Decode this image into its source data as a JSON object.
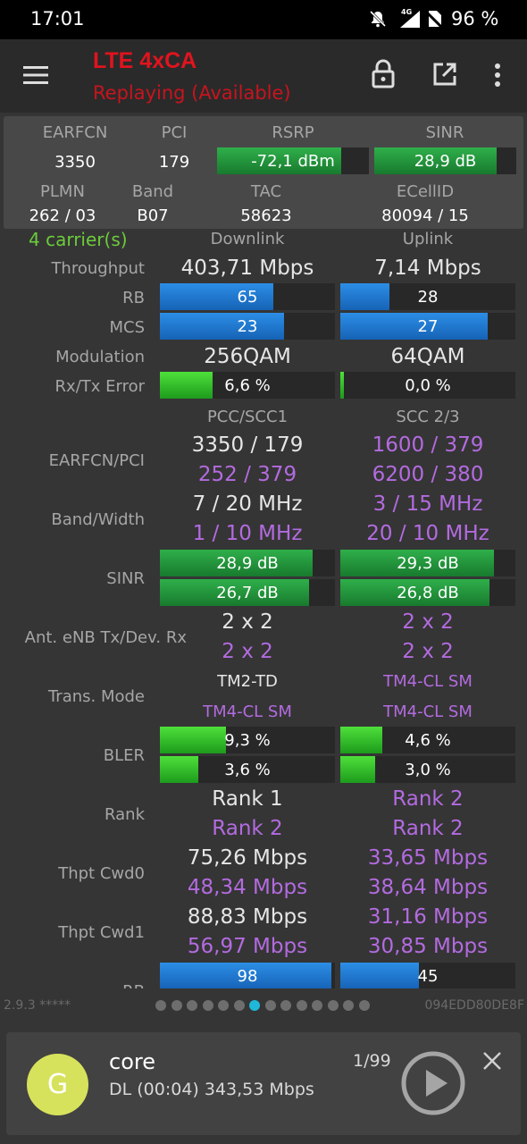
{
  "status_bar": {
    "time": "17:01",
    "network": "4G",
    "battery": "96 %"
  },
  "app_bar": {
    "title": "LTE 4xCA",
    "subtitle": "Replaying (Available)"
  },
  "summary": {
    "headers": {
      "earfcn": "EARFCN",
      "pci": "PCI",
      "rsrp": "RSRP",
      "sinr": "SINR",
      "plmn": "PLMN",
      "band": "Band",
      "tac": "TAC",
      "ecellid": "ECellID"
    },
    "earfcn": "3350",
    "pci": "179",
    "rsrp": "-72,1 dBm",
    "rsrp_level": 0.82,
    "sinr": "28,9 dB",
    "sinr_level": 0.86,
    "plmn": "262 / 03",
    "band": "B07",
    "tac": "58623",
    "ecellid": "80094 / 15"
  },
  "table": {
    "carriers": "4 carrier(s)",
    "col_dl": "Downlink",
    "col_ul": "Uplink",
    "throughput": {
      "label": "Throughput",
      "dl": "403,71 Mbps",
      "ul": "7,14 Mbps"
    },
    "rb": {
      "label": "RB",
      "dl": "65",
      "dl_level": 0.65,
      "ul": "28",
      "ul_level": 0.28
    },
    "mcs": {
      "label": "MCS",
      "dl": "23",
      "dl_level": 0.71,
      "ul": "27",
      "ul_level": 0.84
    },
    "modulation": {
      "label": "Modulation",
      "dl": "256QAM",
      "ul": "64QAM"
    },
    "error": {
      "label": "Rx/Tx Error",
      "dl": "6,6 %",
      "dl_level": 0.3,
      "ul": "0,0 %",
      "ul_level": 0.02
    },
    "col_pcc": "PCC/SCC1",
    "col_scc": "SCC 2/3",
    "earfcn_pci": {
      "label": "EARFCN/PCI",
      "a1": "3350 / 179",
      "a2": "252 / 379",
      "b1": "1600 / 379",
      "b2": "6200 / 380"
    },
    "band_width": {
      "label": "Band/Width",
      "a1": "7 / 20 MHz",
      "a2": "1 / 10 MHz",
      "b1": "3 / 15 MHz",
      "b2": "20 / 10 MHz"
    },
    "sinr": {
      "label": "SINR",
      "a1": "28,9 dB",
      "a1_level": 0.87,
      "a2": "26,7 dB",
      "a2_level": 0.85,
      "b1": "29,3 dB",
      "b1_level": 0.88,
      "b2": "26,8 dB",
      "b2_level": 0.85
    },
    "antenna": {
      "label": "Ant. eNB Tx/Dev. Rx",
      "a1": "2 x 2",
      "a2": "2 x 2",
      "b1": "2 x 2",
      "b2": "2 x 2"
    },
    "trans_mode": {
      "label": "Trans. Mode",
      "a1": "TM2-TD",
      "a2": "TM4-CL SM",
      "b1": "TM4-CL SM",
      "b2": "TM4-CL SM"
    },
    "bler": {
      "label": "BLER",
      "a1": "9,3 %",
      "a1_level": 0.38,
      "a2": "3,6 %",
      "a2_level": 0.22,
      "b1": "4,6 %",
      "b1_level": 0.24,
      "b2": "3,0 %",
      "b2_level": 0.2
    },
    "rank": {
      "label": "Rank",
      "a1": "Rank 1",
      "a2": "Rank 2",
      "b1": "Rank 2",
      "b2": "Rank 2"
    },
    "cwd0": {
      "label": "Thpt Cwd0",
      "a1": "75,26 Mbps",
      "a2": "48,34 Mbps",
      "b1": "33,65 Mbps",
      "b2": "38,64 Mbps"
    },
    "cwd1": {
      "label": "Thpt Cwd1",
      "a1": "88,83 Mbps",
      "a2": "56,97 Mbps",
      "b1": "31,16 Mbps",
      "b2": "30,85 Mbps"
    },
    "rb2": {
      "label": "RB",
      "a1": "98",
      "a1_level": 0.98,
      "b1": "45",
      "b1_level": 0.45
    }
  },
  "footer": {
    "version": "2.9.3 *****",
    "device_id": "094EDD80DE8F",
    "page_count": 14,
    "active_page": 7
  },
  "player": {
    "avatar_letter": "G",
    "title": "core",
    "subtitle": "DL (00:04) 343,53 Mbps",
    "counter": "1/99"
  },
  "colors": {
    "accent_red": "#e0141e",
    "purple": "#b36be0",
    "green_text": "#6ccc3b",
    "blue_bar": "#1e78d2",
    "green_bar": "#26a443"
  }
}
